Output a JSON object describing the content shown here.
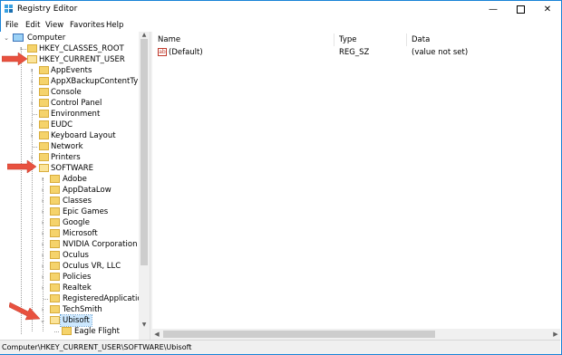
{
  "window": {
    "title": "Registry Editor"
  },
  "menu": [
    "File",
    "Edit",
    "View",
    "Favorites",
    "Help"
  ],
  "tree": {
    "root": "Computer",
    "nodes": [
      {
        "label": "HKEY_CLASSES_ROOT"
      },
      {
        "label": "HKEY_CURRENT_USER"
      },
      {
        "label": "AppEvents"
      },
      {
        "label": "AppXBackupContentType"
      },
      {
        "label": "Console"
      },
      {
        "label": "Control Panel"
      },
      {
        "label": "Environment"
      },
      {
        "label": "EUDC"
      },
      {
        "label": "Keyboard Layout"
      },
      {
        "label": "Network"
      },
      {
        "label": "Printers"
      },
      {
        "label": "SOFTWARE"
      },
      {
        "label": "Adobe"
      },
      {
        "label": "AppDataLow"
      },
      {
        "label": "Classes"
      },
      {
        "label": "Epic Games"
      },
      {
        "label": "Google"
      },
      {
        "label": "Microsoft"
      },
      {
        "label": "NVIDIA Corporation"
      },
      {
        "label": "Oculus"
      },
      {
        "label": "Oculus VR, LLC"
      },
      {
        "label": "Policies"
      },
      {
        "label": "Realtek"
      },
      {
        "label": "RegisteredApplications"
      },
      {
        "label": "TechSmith"
      },
      {
        "label": "Ubisoft"
      },
      {
        "label": "Eagle Flight"
      }
    ]
  },
  "list": {
    "columns": [
      "Name",
      "Type",
      "Data"
    ],
    "rows": [
      {
        "name": "(Default)",
        "type": "REG_SZ",
        "data": "(value not set)"
      }
    ]
  },
  "icons": {
    "value_icon": "ab"
  },
  "status": "Computer\\HKEY_CURRENT_USER\\SOFTWARE\\Ubisoft",
  "colors": {
    "arrow": "#e8513f",
    "selection": "#cce8ff",
    "folder": "#f5d36b"
  }
}
